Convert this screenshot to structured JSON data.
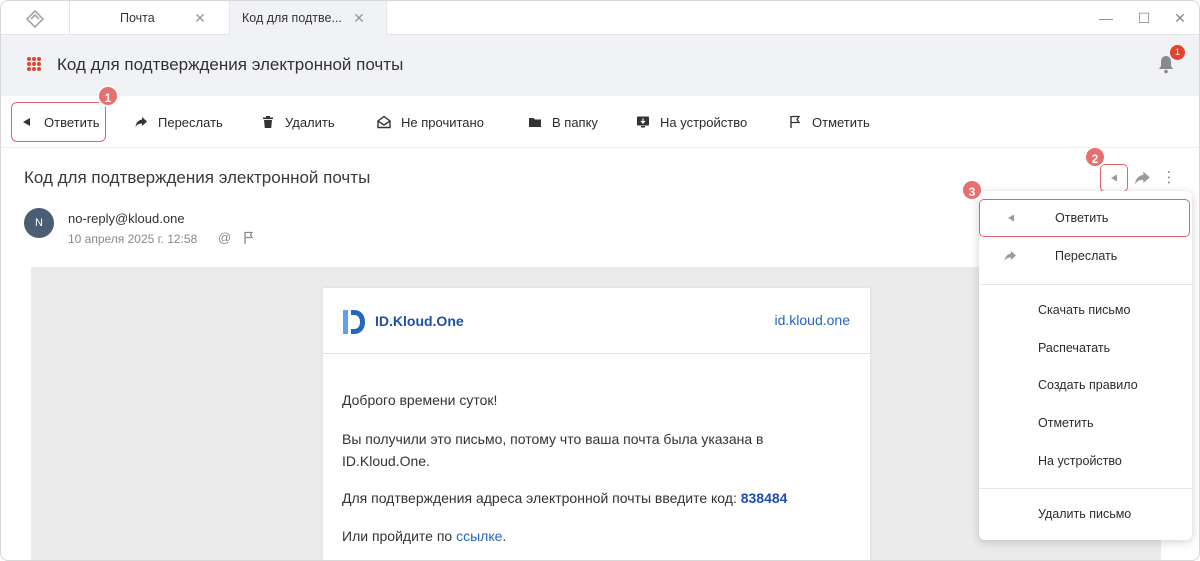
{
  "tabs": [
    {
      "label": "Почта"
    },
    {
      "label": "Код для подтве..."
    }
  ],
  "header": {
    "title": "Код для подтверждения электронной почты",
    "notification_count": "1"
  },
  "toolbar": {
    "reply": "Ответить",
    "forward": "Переслать",
    "delete": "Удалить",
    "unread": "Не прочитано",
    "to_folder": "В папку",
    "to_device": "На устройство",
    "flag": "Отметить"
  },
  "callouts": [
    "1",
    "2",
    "3"
  ],
  "message": {
    "subject": "Код для подтверждения электронной почты",
    "avatar_letter": "N",
    "sender": "no-reply@kloud.one",
    "date": "10 апреля 2025 г. 12:58"
  },
  "mail_body": {
    "brand_name": "ID.Kloud.One",
    "brand_link": "id.kloud.one",
    "greeting": "Доброго времени суток!",
    "reason_line1": "Вы получили это письмо, потому что ваша почта была указана в",
    "reason_line2": "ID.Kloud.One.",
    "code_prompt": "Для подтверждения адреса электронной почты введите код:",
    "code": "838484",
    "link_prompt": "Или пройдите по",
    "link_text": "ссылке",
    "link_suffix": "."
  },
  "menu": {
    "reply": "Ответить",
    "forward": "Переслать",
    "download": "Скачать письмо",
    "print": "Распечатать",
    "create_rule": "Создать правило",
    "flag": "Отметить",
    "to_device": "На устройство",
    "delete": "Удалить письмо"
  },
  "colors": {
    "accent": "#e4432d",
    "highlight": "#e0666a",
    "brand": "#1f4fa8"
  },
  "icons": [
    "app-logo-icon",
    "close-icon",
    "minimize-icon",
    "maximize-icon",
    "apps-grid-icon",
    "bell-icon",
    "reply-icon",
    "forward-icon",
    "trash-icon",
    "envelope-open-icon",
    "folder-icon",
    "device-icon",
    "flag-icon",
    "at-icon",
    "more-icon"
  ]
}
